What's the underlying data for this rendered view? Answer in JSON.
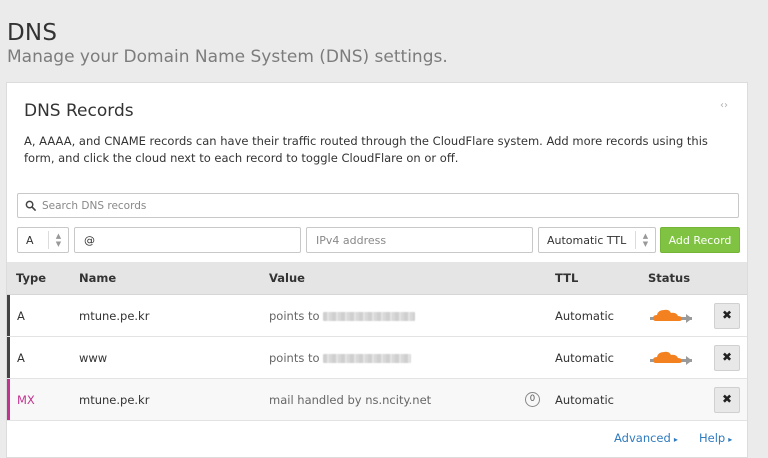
{
  "page": {
    "title": "DNS",
    "subtitle": "Manage your Domain Name System (DNS) settings."
  },
  "card": {
    "title": "DNS Records",
    "description": "A, AAAA, and CNAME records can have their traffic routed through the CloudFlare system. Add more records using this form, and click the cloud next to each record to toggle CloudFlare on or off."
  },
  "search": {
    "placeholder": "Search DNS records",
    "value": ""
  },
  "add_form": {
    "type_value": "A",
    "name_value": "@",
    "value_placeholder": "IPv4 address",
    "ttl_value": "Automatic TTL",
    "add_label": "Add Record"
  },
  "table": {
    "headers": {
      "type": "Type",
      "name": "Name",
      "value": "Value",
      "ttl": "TTL",
      "status": "Status"
    },
    "rows": [
      {
        "type": "A",
        "name": "mtune.pe.kr",
        "value_prefix": "points to",
        "ttl": "Automatic",
        "proxied": true
      },
      {
        "type": "A",
        "name": "www",
        "value_prefix": "points to",
        "ttl": "Automatic",
        "proxied": true
      },
      {
        "type": "MX",
        "name": "mtune.pe.kr",
        "value_prefix": "mail handled by ns.ncity.net",
        "priority": "0",
        "ttl": "Automatic",
        "proxied": false
      }
    ]
  },
  "footer": {
    "advanced": "Advanced",
    "help": "Help"
  },
  "colors": {
    "accent_green": "#80c342",
    "cloud_orange": "#f48120",
    "link_blue": "#2f7bbf",
    "mx_pink": "#c2338f"
  },
  "icons": {
    "search": "search-icon",
    "cloud": "cloud-icon",
    "delete": "close-icon",
    "collapse": "collapse-icon"
  }
}
